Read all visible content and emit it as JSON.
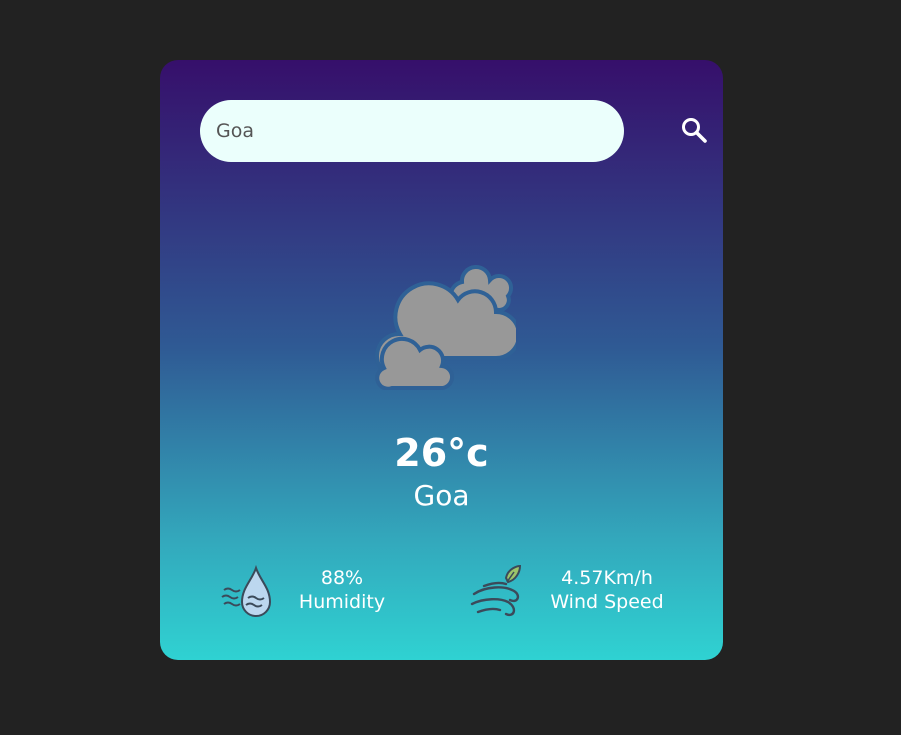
{
  "search": {
    "value": "Goa",
    "button_icon": "search-icon"
  },
  "weather": {
    "icon": "clouds-icon",
    "temperature": "26°c",
    "city": "Goa"
  },
  "humidity": {
    "icon": "humidity-icon",
    "value": "88%",
    "label": "Humidity"
  },
  "wind": {
    "icon": "wind-icon",
    "value": "4.57Km/h",
    "label": "Wind Speed"
  },
  "colors": {
    "page_background": "#222222",
    "card_top": "#360f6b",
    "card_bottom": "#2fd2d2",
    "search_background": "#ebfffc",
    "cloud": "#989898"
  }
}
